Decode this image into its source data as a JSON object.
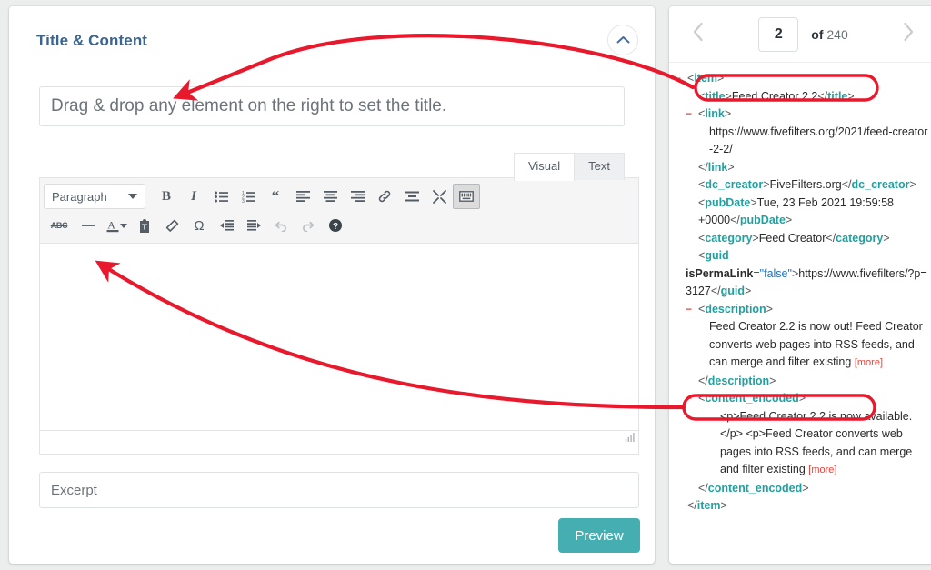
{
  "left_panel": {
    "title": "Title & Content",
    "collapse_icon": "chevron-up-icon",
    "title_field": {
      "value": "",
      "placeholder": "Drag & drop any element on the right to set the title."
    },
    "editor": {
      "tabs": [
        {
          "label": "Visual",
          "active": true
        },
        {
          "label": "Text",
          "active": false
        }
      ],
      "format_select": {
        "value": "Paragraph",
        "caret_icon": "chevron-down-icon"
      },
      "toolbar_row1": [
        {
          "name": "bold-icon",
          "label": "B"
        },
        {
          "name": "italic-icon",
          "label": "I"
        },
        {
          "name": "bulleted-list-icon",
          "label": ""
        },
        {
          "name": "numbered-list-icon",
          "label": ""
        },
        {
          "name": "blockquote-icon",
          "label": "“"
        },
        {
          "name": "align-left-icon",
          "label": ""
        },
        {
          "name": "align-center-icon",
          "label": ""
        },
        {
          "name": "align-right-icon",
          "label": ""
        },
        {
          "name": "link-icon",
          "label": ""
        },
        {
          "name": "read-more-icon",
          "label": ""
        },
        {
          "name": "fullscreen-icon",
          "label": ""
        },
        {
          "name": "toolbar-toggle-icon",
          "label": "",
          "pressed": true
        }
      ],
      "toolbar_row2": [
        {
          "name": "strikethrough-icon",
          "label": "ABC"
        },
        {
          "name": "horizontal-rule-icon",
          "label": ""
        },
        {
          "name": "text-color-icon",
          "label": "A"
        },
        {
          "name": "text-color-dropdown-icon",
          "label": ""
        },
        {
          "name": "paste-as-text-icon",
          "label": ""
        },
        {
          "name": "clear-formatting-icon",
          "label": ""
        },
        {
          "name": "special-character-icon",
          "label": "Ω"
        },
        {
          "name": "outdent-icon",
          "label": ""
        },
        {
          "name": "indent-icon",
          "label": ""
        },
        {
          "name": "undo-icon",
          "label": "",
          "disabled": true
        },
        {
          "name": "redo-icon",
          "label": "",
          "disabled": true
        },
        {
          "name": "help-icon",
          "label": "?"
        }
      ],
      "body_value": "",
      "resize_handle_icon": "resize-grip-icon"
    },
    "excerpt_field": {
      "value": "",
      "placeholder": "Excerpt"
    },
    "preview_button": "Preview"
  },
  "right_panel": {
    "pager": {
      "prev_icon": "chevron-left-icon",
      "next_icon": "chevron-right-icon",
      "current": "2",
      "of_label": "of",
      "total": "240"
    },
    "xml": {
      "item_open": "<item>",
      "item_close": "</item>",
      "title_line": "<title>Feed Creator 2.2</title>",
      "link_open": "<link>",
      "link_value": "https://www.fivefilters.org/2021/feed-creator-2-2/",
      "link_close": "</link>",
      "dc_creator_line": "<dc_creator>FiveFilters.org</dc_creator>",
      "pubdate_line": "<pubDate>Tue, 23 Feb 2021 19:59:58 +0000</pubDate>",
      "category_line": "<category>Feed Creator</category>",
      "guid_tag": "guid",
      "guid_attr_name": "isPermaLink",
      "guid_attr_value": "\"false\"",
      "guid_value": "https://www.fivefilters/?p=3127",
      "guid_close": "</guid>",
      "description_open": "<description>",
      "description_text": "Feed Creator 2.2 is now out! Feed Creator converts web pages into RSS feeds, and can merge and filter existing",
      "description_more": "[more]",
      "description_close": "</description>",
      "content_encoded_open": "<content_encoded>",
      "content_encoded_text": "<p>Feed Creator 2.2 is now available.</p> <p>Feed Creator converts web pages into RSS feeds, and can merge and filter existing",
      "content_encoded_more": "[more]",
      "content_encoded_close": "</content_encoded>",
      "toggle_glyph": "−",
      "title_tag": "title",
      "link_tag": "link",
      "dc_creator_tag": "dc_creator",
      "pubdate_tag": "pubDate",
      "category_tag": "category",
      "description_tag": "description",
      "content_encoded_tag": "content_encoded",
      "item_tag": "item"
    }
  },
  "annotations": {
    "color": "#e8192c",
    "highlight_title": "title-element-highlight",
    "highlight_content": "content-encoded-element-highlight",
    "arrow_to_title": "arrow-title-to-title-field",
    "arrow_to_body": "arrow-content-to-editor-body"
  }
}
